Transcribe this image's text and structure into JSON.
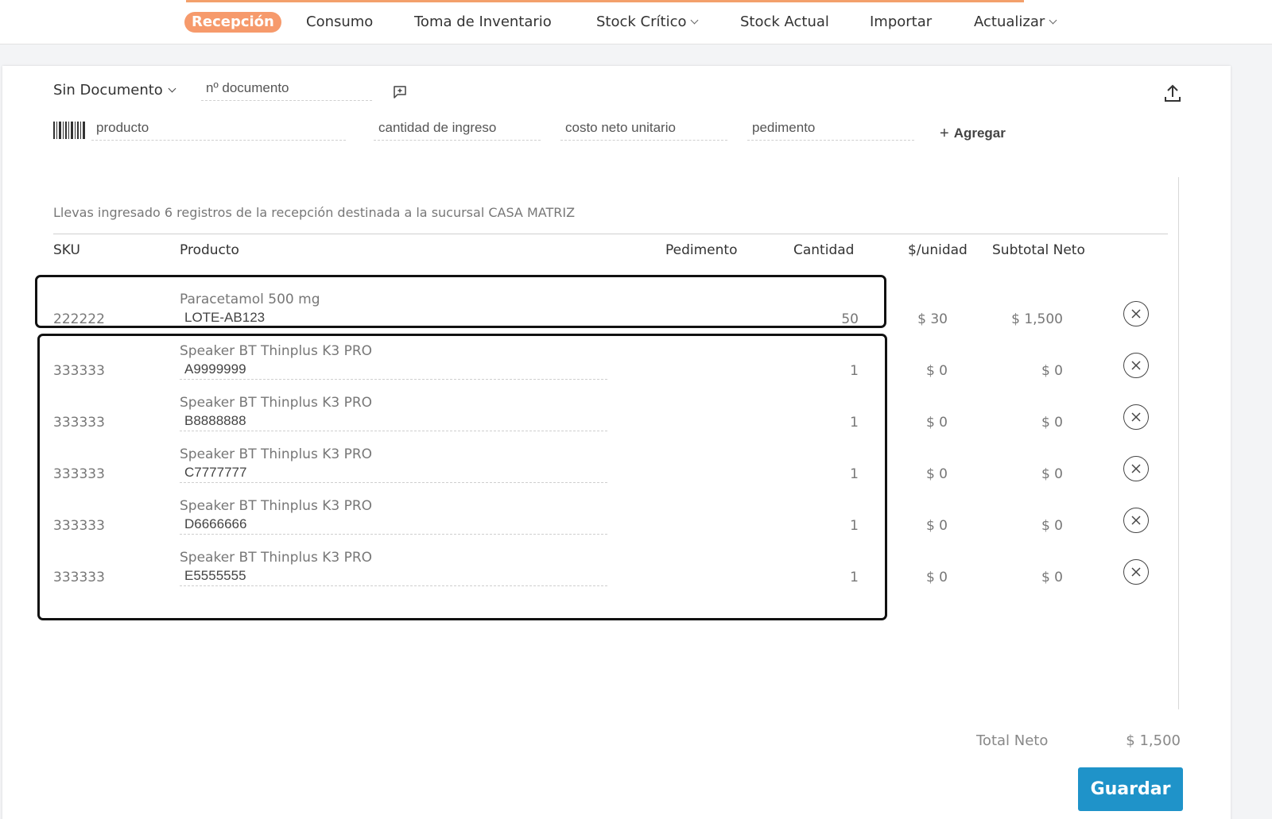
{
  "nav": {
    "items": [
      {
        "label": "Recepción",
        "active": true,
        "dropdown": false
      },
      {
        "label": "Consumo",
        "active": false,
        "dropdown": false
      },
      {
        "label": "Toma de Inventario",
        "active": false,
        "dropdown": false
      },
      {
        "label": "Stock Crítico",
        "active": false,
        "dropdown": true
      },
      {
        "label": "Stock Actual",
        "active": false,
        "dropdown": false
      },
      {
        "label": "Importar",
        "active": false,
        "dropdown": false
      },
      {
        "label": "Actualizar",
        "active": false,
        "dropdown": true
      }
    ],
    "accent_color": "#f69a6c"
  },
  "form": {
    "document_type": "Sin Documento",
    "document_number_placeholder": "nº documento",
    "product_placeholder": "producto",
    "quantity_placeholder": "cantidad de ingreso",
    "cost_placeholder": "costo neto unitario",
    "pedimento_placeholder": "pedimento",
    "add_label": "Agregar",
    "icons": [
      "comment-add-icon",
      "upload-icon",
      "barcode-icon",
      "plus-icon"
    ]
  },
  "info_text": "Llevas ingresado 6 registros de la recepción destinada a la sucursal CASA MATRIZ",
  "table": {
    "headers": {
      "sku": "SKU",
      "producto": "Producto",
      "pedimento": "Pedimento",
      "cantidad": "Cantidad",
      "unidad": "$/unidad",
      "subtotal": "Subtotal Neto"
    },
    "rows": [
      {
        "sku": "222222",
        "producto": "Paracetamol 500 mg",
        "lote": "LOTE-AB123",
        "cantidad": "50",
        "unidad": "$ 30",
        "subtotal": "$ 1,500"
      },
      {
        "sku": "333333",
        "producto": "Speaker BT Thinplus K3 PRO",
        "lote": "A9999999",
        "cantidad": "1",
        "unidad": "$ 0",
        "subtotal": "$ 0"
      },
      {
        "sku": "333333",
        "producto": "Speaker BT Thinplus K3 PRO",
        "lote": "B8888888",
        "cantidad": "1",
        "unidad": "$ 0",
        "subtotal": "$ 0"
      },
      {
        "sku": "333333",
        "producto": "Speaker BT Thinplus K3 PRO",
        "lote": "C7777777",
        "cantidad": "1",
        "unidad": "$ 0",
        "subtotal": "$ 0"
      },
      {
        "sku": "333333",
        "producto": "Speaker BT Thinplus K3 PRO",
        "lote": "D6666666",
        "cantidad": "1",
        "unidad": "$ 0",
        "subtotal": "$ 0"
      },
      {
        "sku": "333333",
        "producto": "Speaker BT Thinplus K3 PRO",
        "lote": "E5555555",
        "cantidad": "1",
        "unidad": "$ 0",
        "subtotal": "$ 0"
      }
    ]
  },
  "totals": {
    "label": "Total Neto",
    "value": "$ 1,500"
  },
  "save_label": "Guardar",
  "save_color": "#1f93c9"
}
